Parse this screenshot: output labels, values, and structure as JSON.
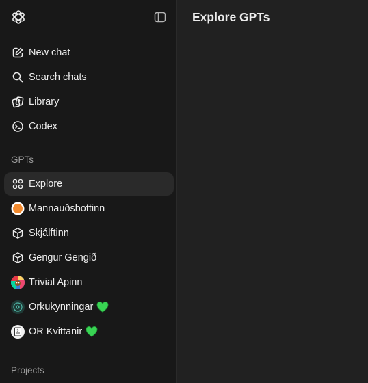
{
  "sidebar": {
    "nav": [
      {
        "label": "New chat",
        "icon": "pencil-square-icon"
      },
      {
        "label": "Search chats",
        "icon": "search-icon"
      },
      {
        "label": "Library",
        "icon": "library-icon"
      },
      {
        "label": "Codex",
        "icon": "terminal-icon"
      }
    ],
    "gpts_label": "GPTs",
    "gpts": [
      {
        "label": "Explore",
        "icon": "grid-dots-icon"
      },
      {
        "label": "Mannauðsbottinn",
        "icon": "orange-dot-avatar"
      },
      {
        "label": "Skjálftinn",
        "icon": "cube-icon"
      },
      {
        "label": "Gengur Gengið",
        "icon": "cube-icon"
      },
      {
        "label": "Trivial Apinn",
        "icon": "colorful-avatar"
      },
      {
        "label": "Orkukynningar",
        "icon": "eye-avatar",
        "suffix": "💚"
      },
      {
        "label": "OR Kvittanir",
        "icon": "receipt-avatar",
        "suffix": "💚"
      }
    ],
    "projects_label": "Projects"
  },
  "main": {
    "title": "Explore GPTs"
  },
  "colors": {
    "sidebar_bg": "#181818",
    "main_bg": "#212121",
    "active_item_bg": "#2a2a2a",
    "heart": "#39d353"
  }
}
